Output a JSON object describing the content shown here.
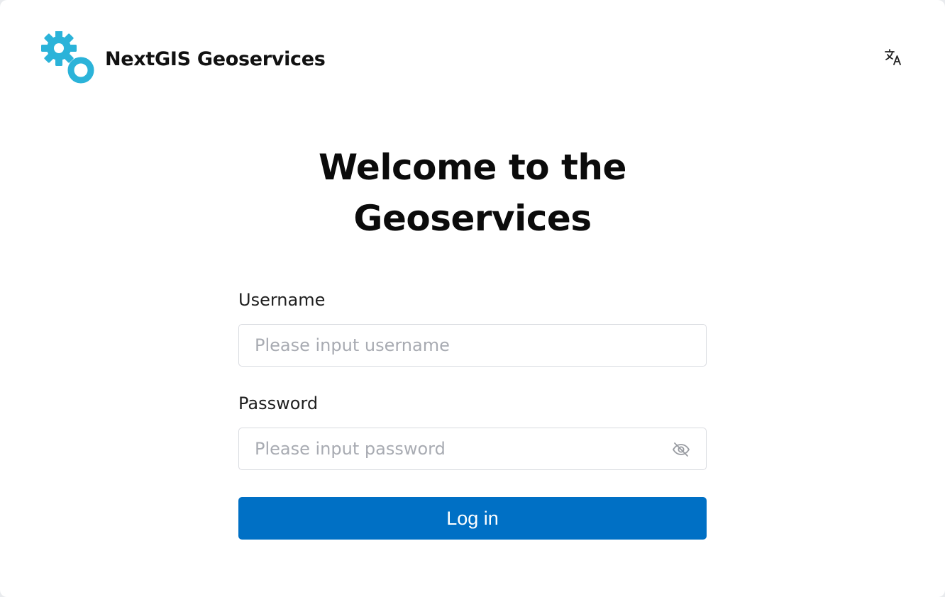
{
  "app": {
    "name": "NextGIS Geoservices",
    "brand_color": "#2bb3d9"
  },
  "header": {
    "language_icon": "translate-icon"
  },
  "title": {
    "line1": "Welcome to the",
    "line2": "Geoservices"
  },
  "form": {
    "username_label": "Username",
    "username_placeholder": "Please input username",
    "username_value": "",
    "password_label": "Password",
    "password_placeholder": "Please input password",
    "password_value": "",
    "password_toggle_icon": "eye-off-icon",
    "login_label": "Log in",
    "login_color": "#0070c5"
  }
}
